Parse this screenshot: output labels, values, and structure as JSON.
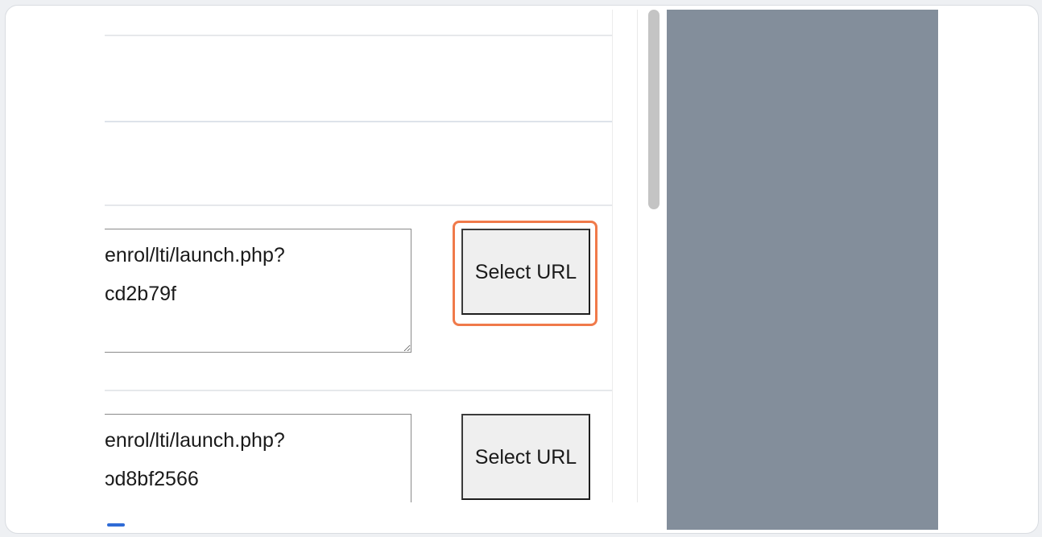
{
  "form": {
    "rows": [
      {
        "url_value": "enrol/lti/launch.php?\ncd2b79f",
        "button_label": "Select URL"
      },
      {
        "url_value": "enrol/lti/launch.php?\nɔd8bf2566",
        "button_label": "Select URL"
      }
    ]
  },
  "colors": {
    "highlight": "#f07a4a",
    "side_panel": "#838e9b",
    "button_bg": "#efefef"
  }
}
